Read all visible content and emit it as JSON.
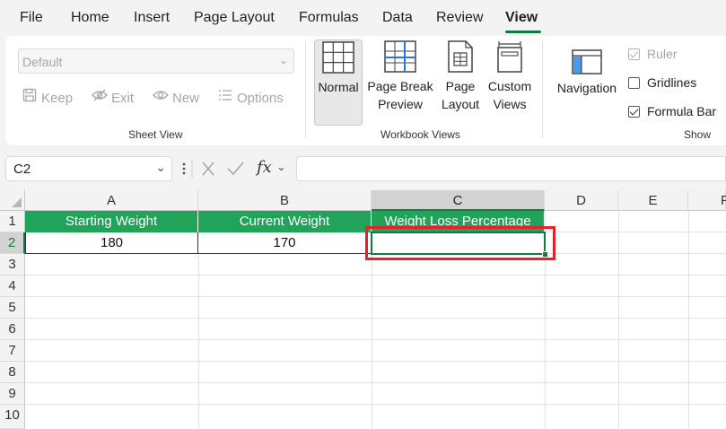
{
  "menu": {
    "tabs": [
      "File",
      "Home",
      "Insert",
      "Page Layout",
      "Formulas",
      "Data",
      "Review",
      "View"
    ],
    "active": "View"
  },
  "ribbon": {
    "sheet_view": {
      "select_value": "Default",
      "keep": "Keep",
      "exit": "Exit",
      "new": "New",
      "options": "Options",
      "group_label": "Sheet View"
    },
    "workbook_views": {
      "normal": "Normal",
      "page_break_line1": "Page Break",
      "page_break_line2": "Preview",
      "page_layout_line1": "Page",
      "page_layout_line2": "Layout",
      "custom_views_line1": "Custom",
      "custom_views_line2": "Views",
      "group_label": "Workbook Views"
    },
    "show": {
      "navigation": "Navigation",
      "ruler": "Ruler",
      "ruler_checked": true,
      "gridlines": "Gridlines",
      "gridlines_checked": false,
      "formula_bar": "Formula Bar",
      "formula_bar_checked": true,
      "group_label": "Show"
    }
  },
  "formula_bar": {
    "name_box": "C2",
    "fx": "fx",
    "formula": ""
  },
  "sheet": {
    "columns": [
      "A",
      "B",
      "C",
      "D",
      "E",
      "F"
    ],
    "selected_column": "C",
    "rows": [
      "1",
      "2",
      "3",
      "4",
      "5",
      "6",
      "7",
      "8",
      "9",
      "10"
    ],
    "selected_row": "2",
    "headers": [
      "Starting Weight",
      "Current Weight",
      "Weight Loss Percentage"
    ],
    "values": [
      "180",
      "170",
      ""
    ],
    "accent_color": "#21a35a",
    "highlight_color": "#e8202a"
  }
}
